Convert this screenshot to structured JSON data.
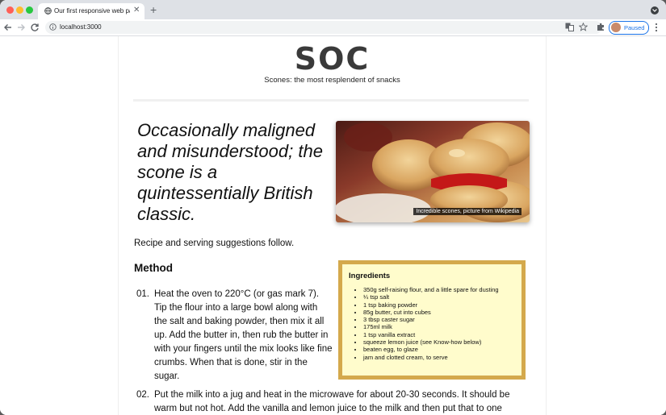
{
  "browser": {
    "tab_title": "Our first responsive web page",
    "tab_close": "✕",
    "new_tab": "+",
    "url": "localhost:3000",
    "profile_label": "Paused"
  },
  "site": {
    "logo": "SOC",
    "tagline": "Scones: the most resplendent of snacks",
    "lead": "Occasionally maligned and misunderstood; the scone is a quintessentially British classic.",
    "image_caption": "Incredible scones, picture from Wikipedia",
    "intro": "Recipe and serving suggestions follow.",
    "method_heading": "Method",
    "steps": [
      {
        "num": "01.",
        "text": "Heat the oven to 220°C (or gas mark 7). Tip the flour into a large bowl along with the salt and baking powder, then mix it all up. Add the butter in, then rub the butter in with your fingers until the mix looks like fine crumbs. When that is done, stir in the sugar."
      },
      {
        "num": "02.",
        "text": "Put the milk into a jug and heat in the microwave for about 20-30 seconds. It should be warm but not hot. Add the vanilla and lemon juice to the milk and then put that to one side and but a baking tray in the oven to warm."
      }
    ],
    "ingredients": {
      "title": "Ingredients",
      "items": [
        "350g self-raising flour, and a little spare for dusting",
        "¼ tsp salt",
        "1 tsp baking powder",
        "85g butter, cut into cubes",
        "3 tbsp caster sugar",
        "175ml milk",
        "1 tsp vanilla extract",
        "squeeze lemon juice (see Know-how below)",
        "beaten egg, to glaze",
        "jam and clotted cream, to serve"
      ]
    }
  },
  "colors": {
    "ingredients_bg": "#fffccc",
    "ingredients_border": "#d4a94c",
    "profile_accent": "#1a73e8"
  }
}
